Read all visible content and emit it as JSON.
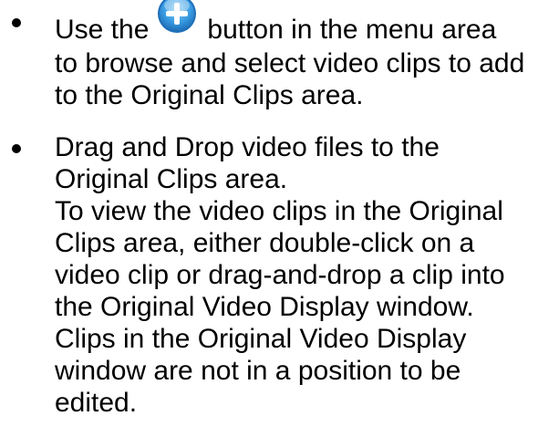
{
  "bullets": [
    {
      "prefix": "Use the",
      "icon": "add-plus-icon",
      "suffix": "button in the menu area",
      "lines": [
        "to browse and select video clips to add",
        "to the Original Clips area."
      ]
    },
    {
      "lines": [
        "Drag and Drop video files to the",
        "Original Clips area.",
        "To view the video clips in the Original",
        "Clips area, either double-click on a",
        "video clip or drag-and-drop a clip into",
        "the Original Video Display window.",
        "Clips in the Original Video Display",
        "window are not in a position to be",
        "edited."
      ]
    }
  ],
  "colors": {
    "text": "#000000",
    "icon_blue": "#1f7fd0",
    "icon_light": "#8fd0f7"
  }
}
